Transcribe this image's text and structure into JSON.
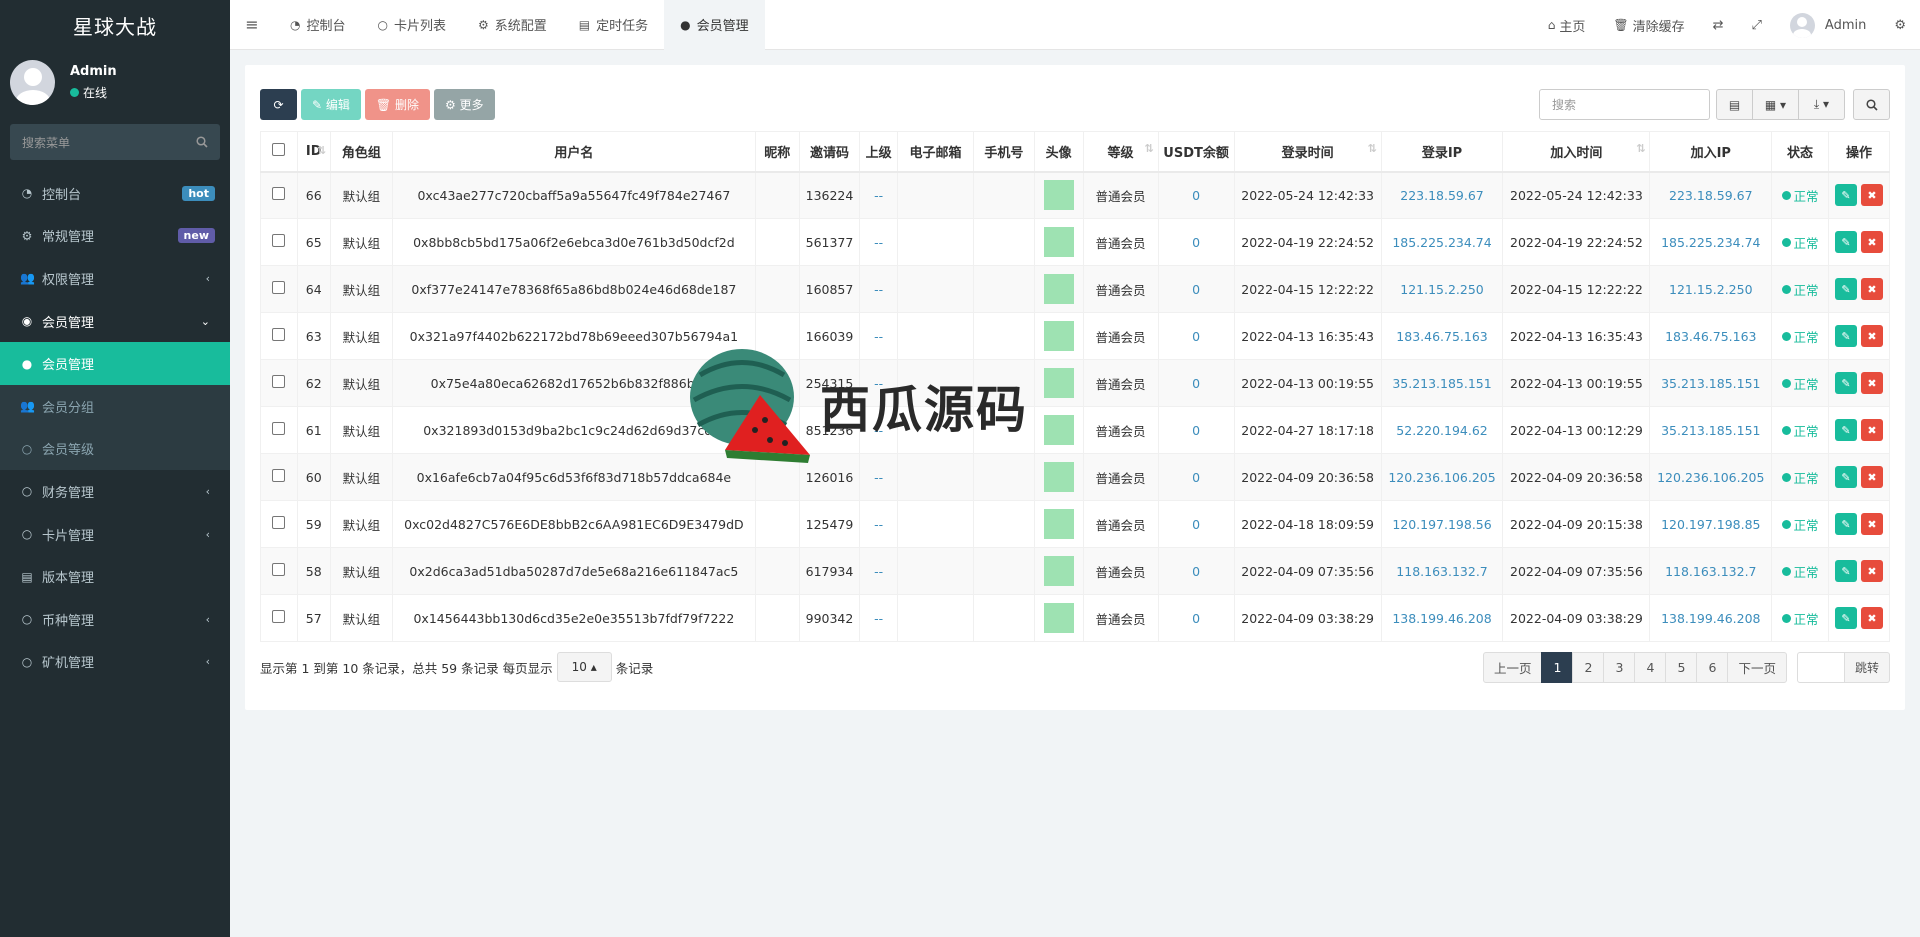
{
  "app": {
    "title": "星球大战"
  },
  "user": {
    "name": "Admin",
    "status": "在线"
  },
  "sidebar": {
    "search_placeholder": "搜索菜单",
    "items": [
      {
        "label": "控制台",
        "icon": "dashboard-icon",
        "badge": "hot"
      },
      {
        "label": "常规管理",
        "icon": "cogs-icon",
        "badge": "new"
      },
      {
        "label": "权限管理",
        "icon": "group-icon",
        "chevron": "left"
      },
      {
        "label": "会员管理",
        "icon": "user-circle-icon",
        "chevron": "down"
      }
    ],
    "submenu": [
      {
        "label": "会员管理",
        "icon": "user-icon",
        "active": true
      },
      {
        "label": "会员分组",
        "icon": "users-icon"
      },
      {
        "label": "会员等级",
        "icon": "circle-o-icon"
      }
    ],
    "items2": [
      {
        "label": "财务管理",
        "icon": "circle-o-icon",
        "chevron": "left"
      },
      {
        "label": "卡片管理",
        "icon": "circle-o-icon",
        "chevron": "left"
      },
      {
        "label": "版本管理",
        "icon": "file-icon"
      },
      {
        "label": "币种管理",
        "icon": "circle-o-icon",
        "chevron": "left"
      },
      {
        "label": "矿机管理",
        "icon": "circle-o-icon",
        "chevron": "left"
      }
    ]
  },
  "topnav": {
    "tabs": [
      {
        "label": "控制台",
        "icon": "dashboard-icon"
      },
      {
        "label": "卡片列表",
        "icon": "circle-o-icon"
      },
      {
        "label": "系统配置",
        "icon": "gear-icon"
      },
      {
        "label": "定时任务",
        "icon": "tasks-icon"
      },
      {
        "label": "会员管理",
        "icon": "user-icon"
      }
    ],
    "right": {
      "home": "主页",
      "clear_cache": "清除缓存",
      "user": "Admin"
    }
  },
  "toolbar": {
    "edit": "编辑",
    "delete": "删除",
    "more": "更多",
    "search_placeholder": "搜索"
  },
  "table": {
    "headers": [
      "ID",
      "角色组",
      "用户名",
      "昵称",
      "邀请码",
      "上级",
      "电子邮箱",
      "手机号",
      "头像",
      "等级",
      "USDT余额",
      "登录时间",
      "登录IP",
      "加入时间",
      "加入IP",
      "状态",
      "操作"
    ],
    "rows": [
      {
        "id": "66",
        "group": "默认组",
        "username": "0xc43ae277c720cbaff5a9a55647fc49f784e27467",
        "nickname": "",
        "invite": "136224",
        "parent": "--",
        "email": "",
        "phone": "",
        "level": "普通会员",
        "usdt": "0",
        "login_time": "2022-05-24 12:42:33",
        "login_ip": "223.18.59.67",
        "join_time": "2022-05-24 12:42:33",
        "join_ip": "223.18.59.67",
        "status": "正常"
      },
      {
        "id": "65",
        "group": "默认组",
        "username": "0x8bb8cb5bd175a06f2e6ebca3d0e761b3d50dcf2d",
        "nickname": "",
        "invite": "561377",
        "parent": "--",
        "email": "",
        "phone": "",
        "level": "普通会员",
        "usdt": "0",
        "login_time": "2022-04-19 22:24:52",
        "login_ip": "185.225.234.74",
        "join_time": "2022-04-19 22:24:52",
        "join_ip": "185.225.234.74",
        "status": "正常"
      },
      {
        "id": "64",
        "group": "默认组",
        "username": "0xf377e24147e78368f65a86bd8b024e46d68de187",
        "nickname": "",
        "invite": "160857",
        "parent": "--",
        "email": "",
        "phone": "",
        "level": "普通会员",
        "usdt": "0",
        "login_time": "2022-04-15 12:22:22",
        "login_ip": "121.15.2.250",
        "join_time": "2022-04-15 12:22:22",
        "join_ip": "121.15.2.250",
        "status": "正常"
      },
      {
        "id": "63",
        "group": "默认组",
        "username": "0x321a97f4402b622172bd78b69eeed307b56794a1",
        "nickname": "",
        "invite": "166039",
        "parent": "--",
        "email": "",
        "phone": "",
        "level": "普通会员",
        "usdt": "0",
        "login_time": "2022-04-13 16:35:43",
        "login_ip": "183.46.75.163",
        "join_time": "2022-04-13 16:35:43",
        "join_ip": "183.46.75.163",
        "status": "正常"
      },
      {
        "id": "62",
        "group": "默认组",
        "username": "0x75e4a80eca62682d17652b6b832f886ba4c",
        "nickname": "",
        "invite": "254315",
        "parent": "--",
        "email": "",
        "phone": "",
        "level": "普通会员",
        "usdt": "0",
        "login_time": "2022-04-13 00:19:55",
        "login_ip": "35.213.185.151",
        "join_time": "2022-04-13 00:19:55",
        "join_ip": "35.213.185.151",
        "status": "正常"
      },
      {
        "id": "61",
        "group": "默认组",
        "username": "0x321893d0153d9ba2bc1c9c24d62d69d37cd1f",
        "nickname": "",
        "invite": "851236",
        "parent": "--",
        "email": "",
        "phone": "",
        "level": "普通会员",
        "usdt": "0",
        "login_time": "2022-04-27 18:17:18",
        "login_ip": "52.220.194.62",
        "join_time": "2022-04-13 00:12:29",
        "join_ip": "35.213.185.151",
        "status": "正常"
      },
      {
        "id": "60",
        "group": "默认组",
        "username": "0x16afe6cb7a04f95c6d53f6f83d718b57ddca684e",
        "nickname": "",
        "invite": "126016",
        "parent": "--",
        "email": "",
        "phone": "",
        "level": "普通会员",
        "usdt": "0",
        "login_time": "2022-04-09 20:36:58",
        "login_ip": "120.236.106.205",
        "join_time": "2022-04-09 20:36:58",
        "join_ip": "120.236.106.205",
        "status": "正常"
      },
      {
        "id": "59",
        "group": "默认组",
        "username": "0xc02d4827C576E6DE8bbB2c6AA981EC6D9E3479dD",
        "nickname": "",
        "invite": "125479",
        "parent": "--",
        "email": "",
        "phone": "",
        "level": "普通会员",
        "usdt": "0",
        "login_time": "2022-04-18 18:09:59",
        "login_ip": "120.197.198.56",
        "join_time": "2022-04-09 20:15:38",
        "join_ip": "120.197.198.85",
        "status": "正常"
      },
      {
        "id": "58",
        "group": "默认组",
        "username": "0x2d6ca3ad51dba50287d7de5e68a216e611847ac5",
        "nickname": "",
        "invite": "617934",
        "parent": "--",
        "email": "",
        "phone": "",
        "level": "普通会员",
        "usdt": "0",
        "login_time": "2022-04-09 07:35:56",
        "login_ip": "118.163.132.7",
        "join_time": "2022-04-09 07:35:56",
        "join_ip": "118.163.132.7",
        "status": "正常"
      },
      {
        "id": "57",
        "group": "默认组",
        "username": "0x1456443bb130d6cd35e2e0e35513b7fdf79f7222",
        "nickname": "",
        "invite": "990342",
        "parent": "--",
        "email": "",
        "phone": "",
        "level": "普通会员",
        "usdt": "0",
        "login_time": "2022-04-09 03:38:29",
        "login_ip": "138.199.46.208",
        "join_time": "2022-04-09 03:38:29",
        "join_ip": "138.199.46.208",
        "status": "正常"
      }
    ]
  },
  "pagination": {
    "info_prefix": "显示第 1 到第 10 条记录，总共 59 条记录 每页显示",
    "page_size": "10",
    "info_suffix": "条记录",
    "prev": "上一页",
    "pages": [
      "1",
      "2",
      "3",
      "4",
      "5",
      "6"
    ],
    "current": "1",
    "next": "下一页",
    "jump": "跳转"
  },
  "watermark": {
    "text": "西瓜源码"
  },
  "colors": {
    "sidebar": "#222d32",
    "accent": "#18bc9c",
    "danger": "#e74c3c",
    "primary_dark": "#2c3e50",
    "link": "#3c8dbc"
  }
}
